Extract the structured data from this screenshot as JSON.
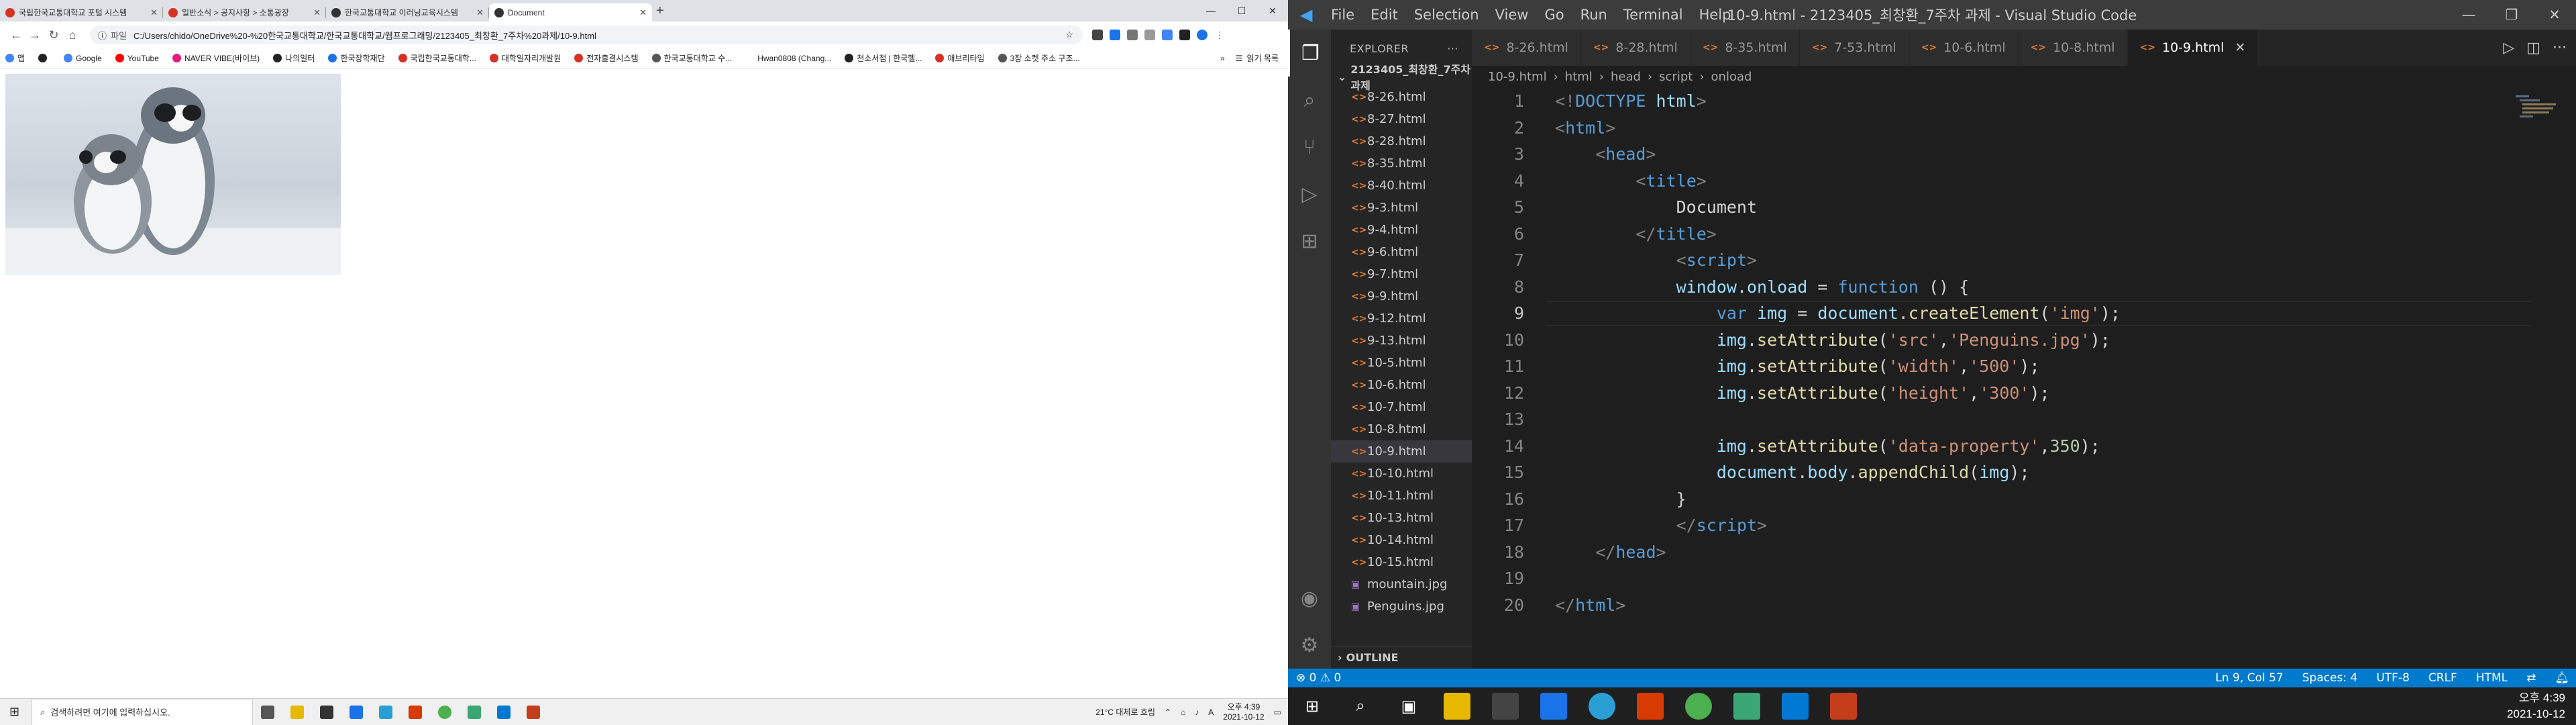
{
  "chrome": {
    "tabs": [
      {
        "label": "국립한국교통대학교 포털 시스템",
        "color": "#d93025"
      },
      {
        "label": "일반소식 > 공지사항 > 소통광장",
        "color": "#d93025"
      },
      {
        "label": "한국교통대학교 이러닝교육시스템",
        "color": "#333333"
      },
      {
        "label": "Document",
        "color": "#333333"
      }
    ],
    "url_prefix": "파일",
    "url": "C:/Users/chido/OneDrive%20-%20한국교통대학교/한국교통대학교/웹프로그래밍/2123405_최창환_7주차%20과제/10-9.html",
    "bookmarks": [
      {
        "label": "앱",
        "color": "#4285f4"
      },
      {
        "label": "",
        "color": "#222222"
      },
      {
        "label": "Google",
        "color": "#4285f4"
      },
      {
        "label": "YouTube",
        "color": "#ff0000"
      },
      {
        "label": "NAVER VIBE(바이브)",
        "color": "#e5197e"
      },
      {
        "label": "나의일터",
        "color": "#222222"
      },
      {
        "label": "한국장학재단",
        "color": "#1a73e8"
      },
      {
        "label": "국립한국교통대학...",
        "color": "#d93025"
      },
      {
        "label": "대학일자리개발원",
        "color": "#d93025"
      },
      {
        "label": "전자출결시스템",
        "color": "#d93025"
      },
      {
        "label": "한국교통대학교 수...",
        "color": "#555555"
      },
      {
        "label": "Hwan0808 (Chang...",
        "color": "#ffffff"
      },
      {
        "label": "천소서점 | 한국헬...",
        "color": "#222222"
      },
      {
        "label": "애브리타임",
        "color": "#d93025"
      },
      {
        "label": "3장 소켓 주소 구조...",
        "color": "#555555"
      }
    ],
    "bookmarks_more": "»",
    "reading_list": "읽기 목록"
  },
  "taskbar_left": {
    "search_placeholder": "검색하려면 여기에 입력하십시오.",
    "weather": "21°C 대체로 흐림",
    "ime": "A",
    "time": "오후 4:39",
    "date": "2021-10-12"
  },
  "vscode": {
    "menu": [
      "File",
      "Edit",
      "Selection",
      "View",
      "Go",
      "Run",
      "Terminal",
      "Help"
    ],
    "title": "10-9.html - 2123405_최창환_7주차 과제 - Visual Studio Code",
    "explorer_header": "EXPLORER",
    "project": "2123405_최창환_7주차 과제",
    "files": [
      "8-26.html",
      "8-27.html",
      "8-28.html",
      "8-35.html",
      "8-40.html",
      "9-3.html",
      "9-4.html",
      "9-6.html",
      "9-7.html",
      "9-9.html",
      "9-12.html",
      "9-13.html",
      "10-5.html",
      "10-6.html",
      "10-7.html",
      "10-8.html",
      "10-9.html",
      "10-10.html",
      "10-11.html",
      "10-13.html",
      "10-14.html",
      "10-15.html",
      "mountain.jpg",
      "Penguins.jpg"
    ],
    "selected_file": "10-9.html",
    "outline": "OUTLINE",
    "tabs": [
      "8-26.html",
      "8-28.html",
      "8-35.html",
      "7-53.html",
      "10-6.html",
      "10-8.html",
      "10-9.html"
    ],
    "active_tab": "10-9.html",
    "breadcrumb": [
      "10-9.html",
      "html",
      "head",
      "script",
      "onload"
    ],
    "current_line": 9,
    "code_lines": [
      [
        [
          "br",
          "<!"
        ],
        [
          "tag",
          "DOCTYPE"
        ],
        [
          "txt",
          " "
        ],
        [
          "var",
          "html"
        ],
        [
          "br",
          ">"
        ]
      ],
      [
        [
          "br",
          "<"
        ],
        [
          "tag",
          "html"
        ],
        [
          "br",
          ">"
        ]
      ],
      [
        [
          "txt",
          "    "
        ],
        [
          "br",
          "<"
        ],
        [
          "tag",
          "head"
        ],
        [
          "br",
          ">"
        ]
      ],
      [
        [
          "txt",
          "        "
        ],
        [
          "br",
          "<"
        ],
        [
          "tag",
          "title"
        ],
        [
          "br",
          ">"
        ]
      ],
      [
        [
          "txt",
          "            Document"
        ]
      ],
      [
        [
          "txt",
          "        "
        ],
        [
          "br",
          "</"
        ],
        [
          "tag",
          "title"
        ],
        [
          "br",
          ">"
        ]
      ],
      [
        [
          "txt",
          "            "
        ],
        [
          "br",
          "<"
        ],
        [
          "tag",
          "script"
        ],
        [
          "br",
          ">"
        ]
      ],
      [
        [
          "txt",
          "            "
        ],
        [
          "var",
          "window"
        ],
        [
          "txt",
          "."
        ],
        [
          "var",
          "onload"
        ],
        [
          "txt",
          " = "
        ],
        [
          "kw",
          "function"
        ],
        [
          "txt",
          " () {"
        ]
      ],
      [
        [
          "txt",
          "                "
        ],
        [
          "kw",
          "var"
        ],
        [
          "txt",
          " "
        ],
        [
          "var",
          "img"
        ],
        [
          "txt",
          " = "
        ],
        [
          "var",
          "document"
        ],
        [
          "txt",
          "."
        ],
        [
          "fn",
          "createElement"
        ],
        [
          "txt",
          "("
        ],
        [
          "str",
          "'img'"
        ],
        [
          "txt",
          ");"
        ]
      ],
      [
        [
          "txt",
          "                "
        ],
        [
          "var",
          "img"
        ],
        [
          "txt",
          "."
        ],
        [
          "fn",
          "setAttribute"
        ],
        [
          "txt",
          "("
        ],
        [
          "str",
          "'src'"
        ],
        [
          "txt",
          ","
        ],
        [
          "str",
          "'Penguins.jpg'"
        ],
        [
          "txt",
          ");"
        ]
      ],
      [
        [
          "txt",
          "                "
        ],
        [
          "var",
          "img"
        ],
        [
          "txt",
          "."
        ],
        [
          "fn",
          "setAttribute"
        ],
        [
          "txt",
          "("
        ],
        [
          "str",
          "'width'"
        ],
        [
          "txt",
          ","
        ],
        [
          "str",
          "'500'"
        ],
        [
          "txt",
          ");"
        ]
      ],
      [
        [
          "txt",
          "                "
        ],
        [
          "var",
          "img"
        ],
        [
          "txt",
          "."
        ],
        [
          "fn",
          "setAttribute"
        ],
        [
          "txt",
          "("
        ],
        [
          "str",
          "'height'"
        ],
        [
          "txt",
          ","
        ],
        [
          "str",
          "'300'"
        ],
        [
          "txt",
          ");"
        ]
      ],
      [
        [
          "txt",
          ""
        ]
      ],
      [
        [
          "txt",
          "                "
        ],
        [
          "var",
          "img"
        ],
        [
          "txt",
          "."
        ],
        [
          "fn",
          "setAttribute"
        ],
        [
          "txt",
          "("
        ],
        [
          "str",
          "'data-property'"
        ],
        [
          "txt",
          ","
        ],
        [
          "num",
          "350"
        ],
        [
          "txt",
          ");"
        ]
      ],
      [
        [
          "txt",
          "                "
        ],
        [
          "var",
          "document"
        ],
        [
          "txt",
          "."
        ],
        [
          "var",
          "body"
        ],
        [
          "txt",
          "."
        ],
        [
          "fn",
          "appendChild"
        ],
        [
          "txt",
          "("
        ],
        [
          "var",
          "img"
        ],
        [
          "txt",
          ");"
        ]
      ],
      [
        [
          "txt",
          "            }"
        ]
      ],
      [
        [
          "txt",
          "            "
        ],
        [
          "br",
          "</"
        ],
        [
          "tag",
          "script"
        ],
        [
          "br",
          ">"
        ]
      ],
      [
        [
          "txt",
          "    "
        ],
        [
          "br",
          "</"
        ],
        [
          "tag",
          "head"
        ],
        [
          "br",
          ">"
        ]
      ],
      [
        [
          "txt",
          ""
        ]
      ],
      [
        [
          "br",
          "</"
        ],
        [
          "tag",
          "html"
        ],
        [
          "br",
          ">"
        ]
      ]
    ],
    "status": {
      "problems": "⊗ 0 ⚠ 0",
      "position": "Ln 9, Col 57",
      "spaces": "Spaces: 4",
      "encoding": "UTF-8",
      "eol": "CRLF",
      "language": "HTML"
    }
  },
  "taskbar_right": {
    "time": "오후 4:39",
    "date": "2021-10-12"
  }
}
